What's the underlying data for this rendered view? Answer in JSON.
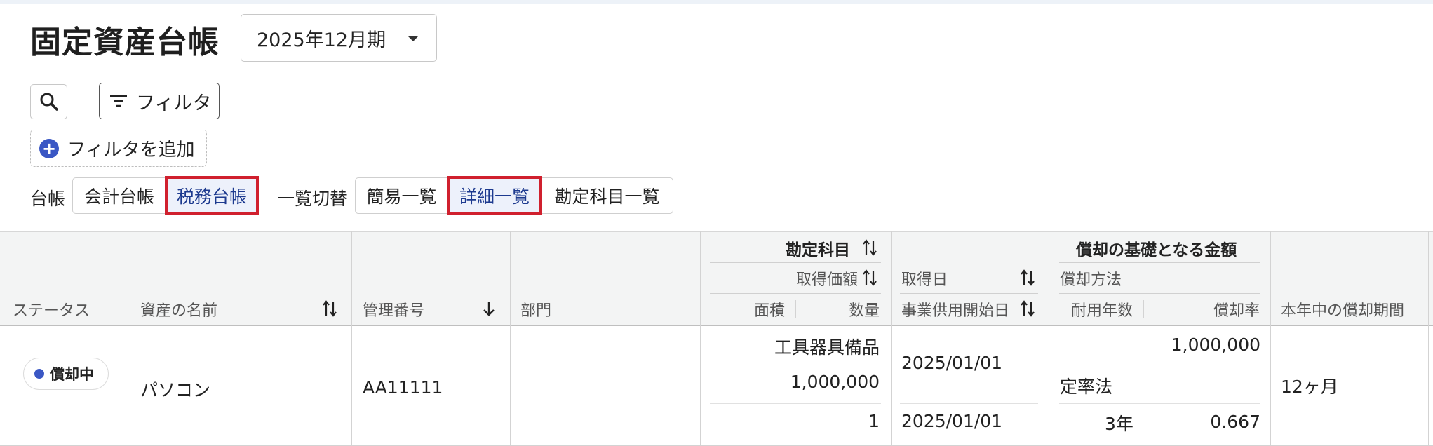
{
  "page": {
    "title": "固定資産台帳"
  },
  "period_selector": {
    "value": "2025年12月期"
  },
  "toolbar": {
    "filter_label": "フィルタ",
    "add_filter_label": "フィルタを追加"
  },
  "ledger": {
    "label": "台帳",
    "options": [
      "会計台帳",
      "税務台帳"
    ],
    "selected": "税務台帳"
  },
  "view": {
    "label": "一覧切替",
    "options": [
      "簡易一覧",
      "詳細一覧",
      "勘定科目一覧"
    ],
    "selected": "詳細一覧"
  },
  "table": {
    "headers": {
      "status": "ステータス",
      "asset_name": "資産の名前",
      "management_no": "管理番号",
      "department": "部門",
      "account": "勘定科目",
      "acquisition_price": "取得価額",
      "area": "面積",
      "quantity": "数量",
      "acquisition_date": "取得日",
      "service_start_date": "事業供用開始日",
      "depreciation_base": "償却の基礎となる金額",
      "depreciation_method": "償却方法",
      "useful_life": "耐用年数",
      "depreciation_rate": "償却率",
      "period_in_year": "本年中の償却期間"
    },
    "rows": [
      {
        "status": "償却中",
        "asset_name": "パソコン",
        "management_no": "AA11111",
        "department": "",
        "account": "工具器具備品",
        "acquisition_price": "1,000,000",
        "quantity": "1",
        "acquisition_date": "2025/01/01",
        "service_start_date": "2025/01/01",
        "depreciation_base": "1,000,000",
        "depreciation_method": "定率法",
        "useful_life": "3年",
        "depreciation_rate": "0.667",
        "period_in_year": "12ヶ月"
      }
    ]
  },
  "colors": {
    "accent": "#3a57c4",
    "highlight_border": "#d0202e",
    "header_bg": "#f3f4f4"
  }
}
